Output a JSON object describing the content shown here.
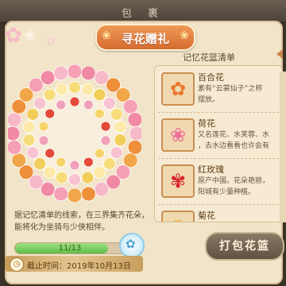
{
  "top_bar": {
    "title": "包 裹"
  },
  "event": {
    "title": "寻花赠礼"
  },
  "list": {
    "header": "记忆花篮清单",
    "items": [
      {
        "name": "百合花",
        "desc": [
          "素有“云裳仙子”之称",
          "摆放。"
        ],
        "icon": "orange-lily-icon",
        "glyph": "✿",
        "color": "#e8772c"
      },
      {
        "name": "荷花",
        "desc": [
          "又名莲花、水芙蓉、水",
          "，去水边看看也许会有"
        ],
        "icon": "pink-lotus-icon",
        "glyph": "❀",
        "color": "#ee6f9a"
      },
      {
        "name": "红玫瑰",
        "desc": [
          "原产中国。花朵艳丽，",
          "阳城有少量种植。"
        ],
        "icon": "red-rose-icon",
        "glyph": "✾",
        "color": "#d8262a"
      },
      {
        "name": "菊花",
        "desc": [],
        "icon": "chrysanthemum-icon",
        "glyph": "✺",
        "color": "#e99a2a"
      }
    ]
  },
  "description": [
    "据记忆清单的线索，在三界集齐花朵，",
    "能将化为坐骑与少侠相伴。"
  ],
  "progress": {
    "text": "11/13",
    "current": 11,
    "total": 13
  },
  "deadline": {
    "text": "截止时间：2019年10月13日"
  },
  "actions": {
    "pack_label": "打包花篮"
  },
  "colors": {
    "accent": "#d66b2e",
    "panel": "#f1e4c8",
    "progress": "#5dbd49"
  }
}
